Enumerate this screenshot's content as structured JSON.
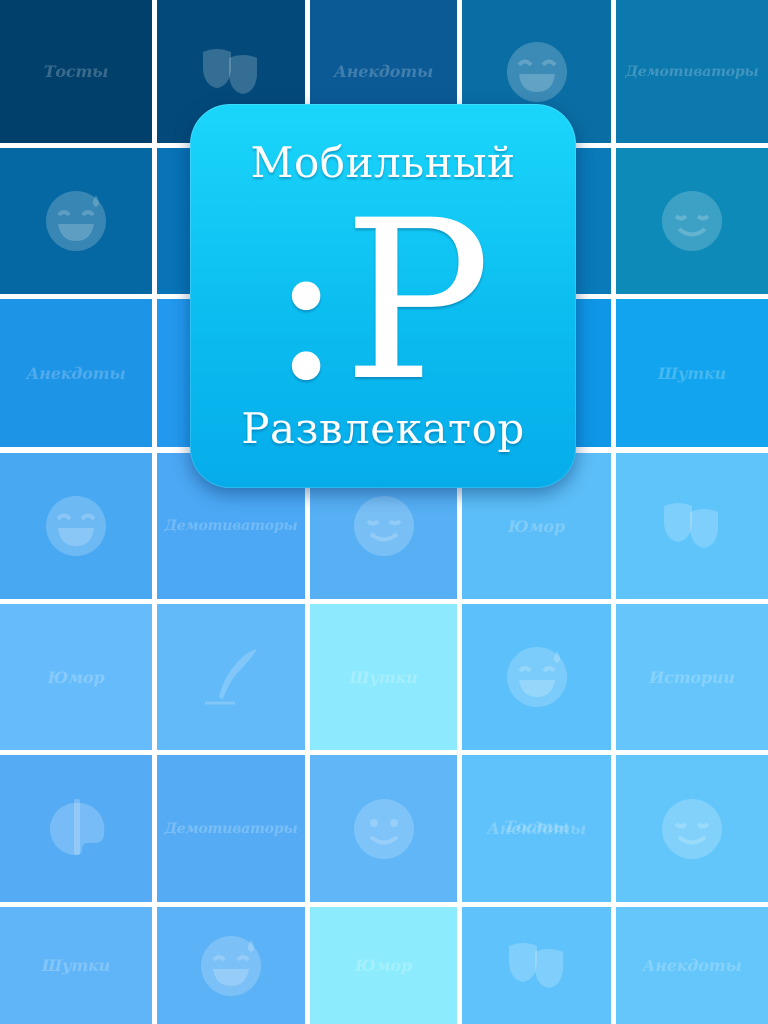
{
  "app": {
    "title_top": "Мобильный",
    "logo": ":P",
    "title_bottom": "Развлекатор"
  },
  "grid": {
    "rows": [
      [
        {
          "kind": "text",
          "label": "Тосты",
          "color": "#02406c"
        },
        {
          "kind": "icon",
          "icon": "theater-masks-icon",
          "color": "#034a7a"
        },
        {
          "kind": "text",
          "label": "Анекдоты",
          "color": "#0b5a96"
        },
        {
          "kind": "icon",
          "icon": "laughing-face-icon",
          "color": "#0a6ea4"
        },
        {
          "kind": "text",
          "label": "Демотиваторы",
          "color": "#0b78ae"
        }
      ],
      [
        {
          "kind": "icon",
          "icon": "sweat-smile-face-icon",
          "color": "#0668a2"
        },
        {
          "kind": "blank",
          "color": "#0873b6"
        },
        {
          "kind": "blank",
          "color": "#0b84c8"
        },
        {
          "kind": "blank",
          "color": "#0a7ab8"
        },
        {
          "kind": "icon",
          "icon": "smiling-face-icon",
          "color": "#0d8ab8"
        }
      ],
      [
        {
          "kind": "text",
          "label": "Анекдоты",
          "color": "#1e94e6"
        },
        {
          "kind": "blank",
          "color": "#2299ee"
        },
        {
          "kind": "blank",
          "color": "#1a8de0"
        },
        {
          "kind": "blank",
          "color": "#0f96e6"
        },
        {
          "kind": "text",
          "label": "Шутки",
          "color": "#12a4ee"
        }
      ],
      [
        {
          "kind": "icon",
          "icon": "laughing-face-icon",
          "color": "#49a8f2"
        },
        {
          "kind": "text",
          "label": "Демотиваторы",
          "color": "#4ca8f4"
        },
        {
          "kind": "icon",
          "icon": "smiling-face-icon",
          "color": "#57b0f4"
        },
        {
          "kind": "text",
          "label": "Юмор",
          "color": "#5cbef8"
        },
        {
          "kind": "icon",
          "icon": "theater-masks-icon",
          "color": "#5ec4fa"
        }
      ],
      [
        {
          "kind": "text",
          "label": "Юмор",
          "color": "#66bcfa"
        },
        {
          "kind": "icon",
          "icon": "quill-pen-icon",
          "color": "#62baf8"
        },
        {
          "kind": "text",
          "label": "Шутки",
          "color": "#8de9fd"
        },
        {
          "kind": "icon",
          "icon": "sweat-smile-face-icon",
          "color": "#5cc0fa"
        },
        {
          "kind": "text",
          "label": "Истории",
          "color": "#66c6fb"
        }
      ],
      [
        {
          "kind": "icon",
          "icon": "palette-icon",
          "color": "#56acf4"
        },
        {
          "kind": "text",
          "label": "Демотиваторы",
          "color": "#55acf4"
        },
        {
          "kind": "icon",
          "icon": "smile-face-icon",
          "color": "#60b6f7"
        },
        {
          "kind": "text",
          "label": "Анекдоты",
          "color": "#5fc2fa"
        },
        {
          "kind": "icon",
          "icon": "smiling-face-icon",
          "color": "#62c6fb"
        }
      ],
      [
        {
          "kind": "text",
          "label": "Шутки",
          "color": "#5fb5f7"
        },
        {
          "kind": "icon",
          "icon": "sweat-smile-face-icon",
          "color": "#5bb2f6"
        },
        {
          "kind": "text",
          "label": "Юмор",
          "color": "#8cecfd"
        },
        {
          "kind": "icon",
          "icon": "theater-masks-icon",
          "color": "#5fc2fa"
        },
        {
          "kind": "text",
          "label": "Анекдоты",
          "color": "#64c6fb"
        }
      ]
    ],
    "overlays": [
      {
        "row": 5,
        "col": 3,
        "label": "Тосты"
      }
    ]
  }
}
